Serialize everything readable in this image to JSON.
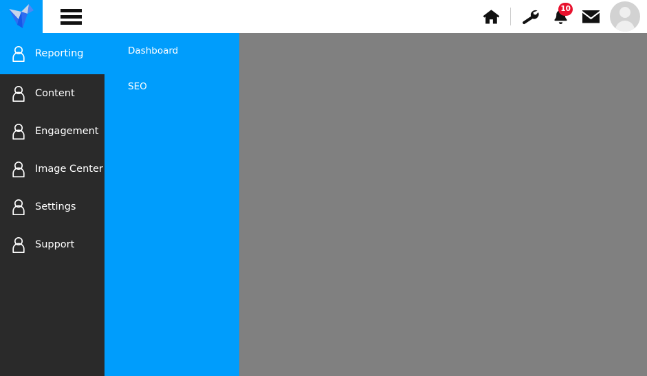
{
  "header": {
    "logo": {
      "name": "brand-logo",
      "colors": [
        "#1558e8",
        "#2f6df0",
        "#9db8ef",
        "#c8d4ea"
      ]
    },
    "menu_toggle_label": "Menu",
    "actions": [
      {
        "name": "home-icon",
        "label": "Home"
      },
      {
        "name": "wrench-icon",
        "label": "Tools"
      },
      {
        "name": "bell-icon",
        "label": "Notifications",
        "badge": "10"
      },
      {
        "name": "envelope-icon",
        "label": "Messages"
      },
      {
        "name": "avatar",
        "label": "User profile"
      }
    ],
    "badge_color": "#e8112d"
  },
  "sidebar": {
    "background": "#2a2a2a",
    "active_color": "#009dfc",
    "items": [
      {
        "label": "Reporting",
        "icon": "user-icon",
        "active": true
      },
      {
        "label": "Content",
        "icon": "user-icon",
        "active": false
      },
      {
        "label": "Engagement",
        "icon": "user-icon",
        "active": false
      },
      {
        "label": "Image Center",
        "icon": "user-icon",
        "active": false
      },
      {
        "label": "Settings",
        "icon": "user-icon",
        "active": false
      },
      {
        "label": "Support",
        "icon": "user-icon",
        "active": false
      }
    ]
  },
  "submenu": {
    "background": "#009dfc",
    "items": [
      {
        "label": "Dashboard"
      },
      {
        "label": "SEO"
      }
    ]
  },
  "content": {
    "background": "#808080",
    "body_text": ""
  }
}
